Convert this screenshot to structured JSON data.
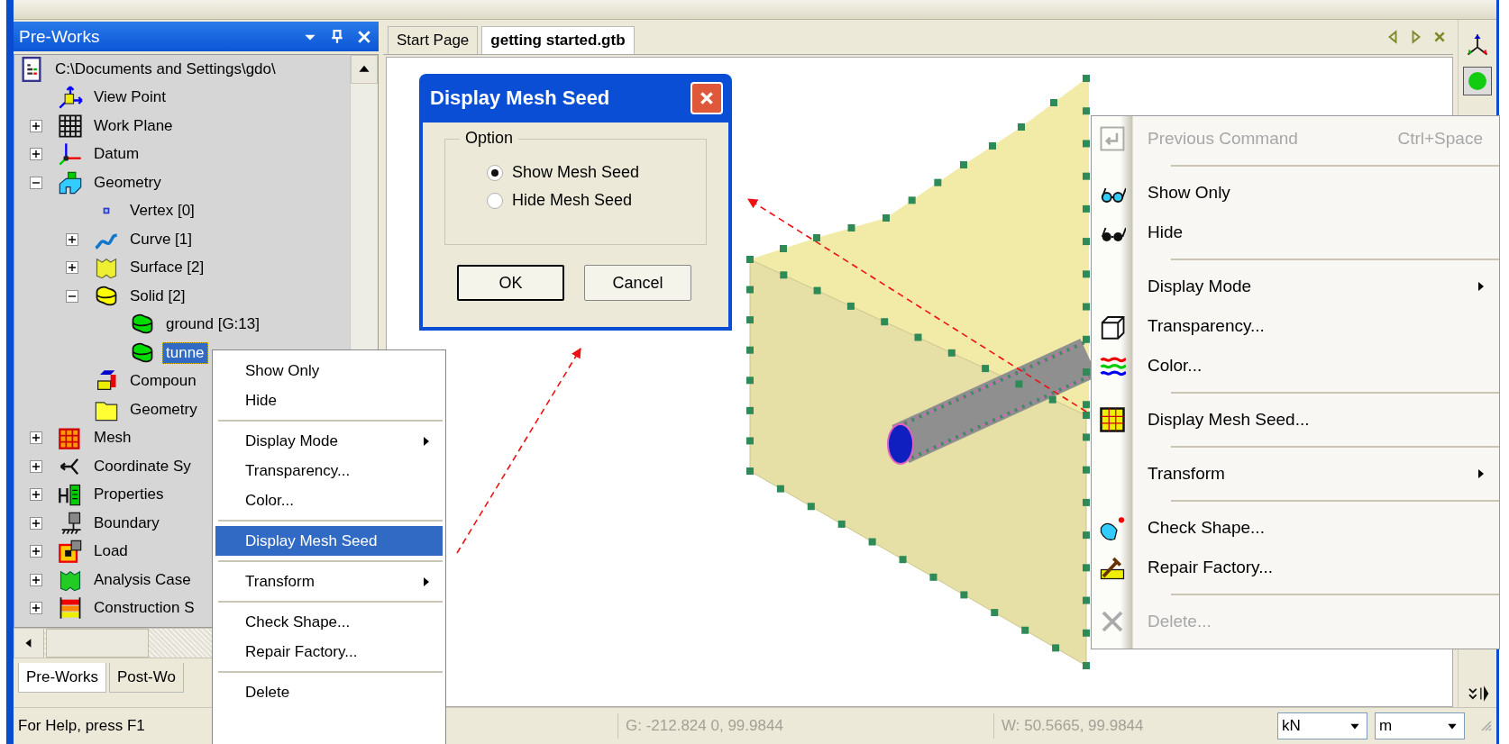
{
  "panel": {
    "title": "Pre-Works"
  },
  "tree": [
    {
      "label": "C:\\Documents and Settings\\gdo\\",
      "kind": "file",
      "selected": false,
      "children": [
        {
          "label": "View Point",
          "kind": "viewpoint",
          "selected": false
        },
        {
          "label": "Work Plane",
          "kind": "grid",
          "selected": false,
          "expanded": false
        },
        {
          "label": "Datum",
          "kind": "datum",
          "selected": false,
          "expanded": false
        },
        {
          "label": "Geometry",
          "kind": "geometry",
          "selected": false,
          "expanded": true,
          "children": [
            {
              "label": "Vertex [0]",
              "kind": "vertex",
              "selected": false
            },
            {
              "label": "Curve [1]",
              "kind": "curve",
              "selected": false,
              "expanded": false
            },
            {
              "label": "Surface [2]",
              "kind": "surface",
              "selected": false,
              "expanded": false
            },
            {
              "label": "Solid [2]",
              "kind": "solid",
              "selected": false,
              "expanded": true,
              "children": [
                {
                  "label": "ground [G:13]",
                  "kind": "part",
                  "selected": false
                },
                {
                  "label": "tunne",
                  "kind": "part",
                  "selected": true
                }
              ]
            },
            {
              "label": "Compoun",
              "kind": "compound",
              "selected": false
            },
            {
              "label": "Geometry",
              "kind": "folder",
              "selected": false
            }
          ]
        },
        {
          "label": "Mesh",
          "kind": "mesh",
          "selected": false,
          "expanded": false
        },
        {
          "label": "Coordinate Sy",
          "kind": "coordinate",
          "selected": false,
          "expanded": false
        },
        {
          "label": "Properties",
          "kind": "properties",
          "selected": false,
          "expanded": false
        },
        {
          "label": "Boundary",
          "kind": "boundary",
          "selected": false,
          "expanded": false
        },
        {
          "label": "Load",
          "kind": "load",
          "selected": false,
          "expanded": false
        },
        {
          "label": "Analysis Case",
          "kind": "analysis",
          "selected": false,
          "expanded": false
        },
        {
          "label": "Construction S",
          "kind": "construction",
          "selected": false,
          "expanded": false
        }
      ]
    }
  ],
  "panel_tabs": [
    {
      "label": "Pre-Works",
      "selected": true
    },
    {
      "label": "Post-Wo",
      "selected": false
    }
  ],
  "doc_tabs": [
    {
      "label": "Start Page",
      "selected": false
    },
    {
      "label": "getting started.gtb",
      "selected": true
    }
  ],
  "dialog": {
    "title": "Display Mesh Seed",
    "group": "Option",
    "options": [
      {
        "label": "Show Mesh Seed",
        "selected": true
      },
      {
        "label": "Hide Mesh Seed",
        "selected": false
      }
    ],
    "buttons": [
      {
        "label": "OK",
        "default": true
      },
      {
        "label": "Cancel",
        "default": false
      }
    ]
  },
  "context_menu": {
    "groups": [
      [
        {
          "label": "Show Only",
          "selected": false,
          "submenu": false
        },
        {
          "label": "Hide",
          "selected": false,
          "submenu": false
        }
      ],
      [
        {
          "label": "Display Mode",
          "selected": false,
          "submenu": true
        },
        {
          "label": "Transparency...",
          "selected": false,
          "submenu": false
        },
        {
          "label": "Color...",
          "selected": false,
          "submenu": false
        }
      ],
      [
        {
          "label": "Display Mesh Seed",
          "selected": true,
          "submenu": false
        }
      ],
      [
        {
          "label": "Transform",
          "selected": false,
          "submenu": true
        }
      ],
      [
        {
          "label": "Check Shape...",
          "selected": false,
          "submenu": false
        },
        {
          "label": "Repair Factory...",
          "selected": false,
          "submenu": false
        }
      ],
      [
        {
          "label": "Delete",
          "selected": false,
          "submenu": false
        }
      ]
    ]
  },
  "popup_menu": {
    "groups": [
      [
        {
          "label": "Previous Command",
          "shortcut": "Ctrl+Space",
          "kind": "enter",
          "disabled": true,
          "submenu": false
        }
      ],
      [
        {
          "label": "Show Only",
          "kind": "show",
          "disabled": false,
          "submenu": false
        },
        {
          "label": "Hide",
          "kind": "hide",
          "disabled": false,
          "submenu": false
        }
      ],
      [
        {
          "label": "Display Mode",
          "kind": "plain",
          "disabled": false,
          "submenu": true
        },
        {
          "label": "Transparency...",
          "kind": "cube",
          "disabled": false,
          "submenu": false
        },
        {
          "label": "Color...",
          "kind": "color",
          "disabled": false,
          "submenu": false
        }
      ],
      [
        {
          "label": "Display Mesh Seed...",
          "kind": "mesh",
          "disabled": false,
          "submenu": false
        }
      ],
      [
        {
          "label": "Transform",
          "kind": "plain",
          "disabled": false,
          "submenu": true
        }
      ],
      [
        {
          "label": "Check Shape...",
          "kind": "check",
          "disabled": false,
          "submenu": false
        },
        {
          "label": "Repair Factory...",
          "kind": "repair",
          "disabled": false,
          "submenu": false
        }
      ],
      [
        {
          "label": "Delete...",
          "kind": "delete",
          "disabled": true,
          "submenu": false
        }
      ]
    ]
  },
  "status_bar": {
    "help": "For Help, press F1",
    "g_coords": "G: -212.824 0, 99.9844",
    "w_coords": "W: 50.5665, 99.9844",
    "units": [
      {
        "value": "kN"
      },
      {
        "value": "m"
      }
    ]
  }
}
